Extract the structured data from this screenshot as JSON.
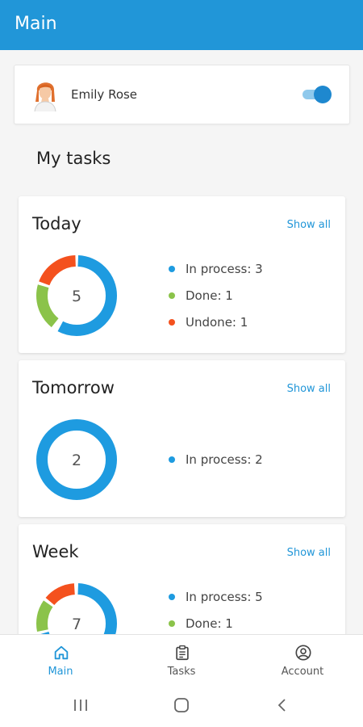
{
  "app_title": "Main",
  "user": {
    "name": "Emily Rose",
    "toggle_on": true
  },
  "section_title": "My tasks",
  "show_all_label": "Show all",
  "colors": {
    "primary": "#2196d8",
    "in_process": "#1e9be0",
    "done": "#8bc34a",
    "undone": "#f4511e"
  },
  "cards": [
    {
      "title": "Today",
      "total": "5",
      "legend": [
        {
          "label": "In process: 3",
          "color": "#1e9be0"
        },
        {
          "label": "Done: 1",
          "color": "#8bc34a"
        },
        {
          "label": "Undone: 1",
          "color": "#f4511e"
        }
      ]
    },
    {
      "title": "Tomorrow",
      "total": "2",
      "legend": [
        {
          "label": "In process: 2",
          "color": "#1e9be0"
        }
      ]
    },
    {
      "title": "Week",
      "total": "7",
      "legend": [
        {
          "label": "In process: 5",
          "color": "#1e9be0"
        },
        {
          "label": "Done: 1",
          "color": "#8bc34a"
        }
      ]
    }
  ],
  "bottom_nav": [
    {
      "label": "Main",
      "icon": "home-icon",
      "active": true
    },
    {
      "label": "Tasks",
      "icon": "clipboard-icon",
      "active": false
    },
    {
      "label": "Account",
      "icon": "account-icon",
      "active": false
    }
  ]
}
